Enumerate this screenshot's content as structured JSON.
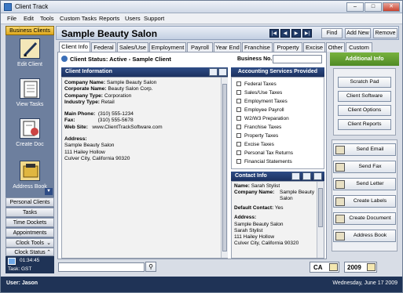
{
  "window": {
    "title": "Client Track"
  },
  "menu": [
    "File",
    "Edit",
    "Tools",
    "Custom Tasks",
    "Reports",
    "Users",
    "Support"
  ],
  "left_nav": {
    "business_clients": "Business Clients",
    "items": [
      {
        "label": "Edit Client",
        "icon": "pen-icon"
      },
      {
        "label": "View Tasks",
        "icon": "notepad-icon"
      },
      {
        "label": "Create Doc",
        "icon": "document-icon"
      },
      {
        "label": "Address Book",
        "icon": "address-book-icon"
      }
    ],
    "lists": [
      "Personal Clients",
      "Tasks",
      "Time Dockets",
      "Appointments",
      "Clock Tools",
      "Clock Status"
    ],
    "clock_time": "01:34:45",
    "task": "Task: GST"
  },
  "header": {
    "client_name": "Sample Beauty Salon",
    "find": "Find",
    "add_new": "Add New",
    "remove": "Remove"
  },
  "tabs": [
    "Client Info",
    "Federal",
    "Sales/Use",
    "Employment",
    "Payroll",
    "Year End",
    "Franchise",
    "Property",
    "Excise",
    "Other",
    "Custom"
  ],
  "client_status": "Client Status: Active - Sample Client",
  "business_no_label": "Business No.:",
  "business_no_value": "",
  "client_info": {
    "title": "Client Information",
    "company_name_label": "Company Name:",
    "company_name": "Sample Beauty Salon",
    "corporate_name_label": "Corporate Name:",
    "corporate_name": "Beauty Salon Corp.",
    "company_type_label": "Company Type:",
    "company_type": "Corporation",
    "industry_type_label": "Industry Type:",
    "industry_type": "Retail",
    "main_phone_label": "Main Phone:",
    "main_phone": "(310) 555-1234",
    "fax_label": "Fax:",
    "fax": "(310) 555-5678",
    "web_label": "Web Site:",
    "web": "www.ClientTrackSoftware.com",
    "address_label": "Address:",
    "address_lines": [
      "Sample Beauty Salon",
      "111 Hailey Hollow",
      "Culver City, California  90320"
    ]
  },
  "accounting": {
    "title": "Accounting Services Provided",
    "items": [
      "Federal Taxes",
      "Sales/Use Taxes",
      "Employment Taxes",
      "Employee Payroll",
      "W2/W3 Preparation",
      "Franchise Taxes",
      "Property Taxes",
      "Excise Taxes",
      "Personal Tax Returns",
      "Financial Statements"
    ]
  },
  "contact": {
    "title": "Contact Info",
    "name_label": "Name:",
    "name": "Sarah Stylist",
    "company_label": "Company Name:",
    "company": "Sample Beauty Salon",
    "default_label": "Default Contact:",
    "default": "Yes",
    "address_label": "Address:",
    "address_lines": [
      "Sample Beauty Salon",
      "Sarah Stylist",
      "111 Hailey Hollow",
      "Culver City, California  90320"
    ]
  },
  "right": {
    "additional_info": "Additional Info",
    "buttons": [
      "Scratch Pad",
      "Client Software",
      "Client Options",
      "Client Reports"
    ],
    "actions": [
      {
        "label": "Send Email",
        "icon": "email-icon"
      },
      {
        "label": "Send Fax",
        "icon": "fax-icon"
      },
      {
        "label": "Send Letter",
        "icon": "letter-icon"
      },
      {
        "label": "Create Labels",
        "icon": "labels-icon"
      },
      {
        "label": "Create Document",
        "icon": "document-icon"
      },
      {
        "label": "Address Book",
        "icon": "address-book-icon"
      }
    ]
  },
  "bottom": {
    "state": "CA",
    "year": "2009"
  },
  "status": {
    "user": "User: Jason",
    "date": "Wednesday, June 17 2009"
  },
  "colors": {
    "nav_bg": "#6d7f9e",
    "header_blue": "#1c315f",
    "additional_green": "#5f9a2f",
    "business_gold": "#e8b62e"
  }
}
